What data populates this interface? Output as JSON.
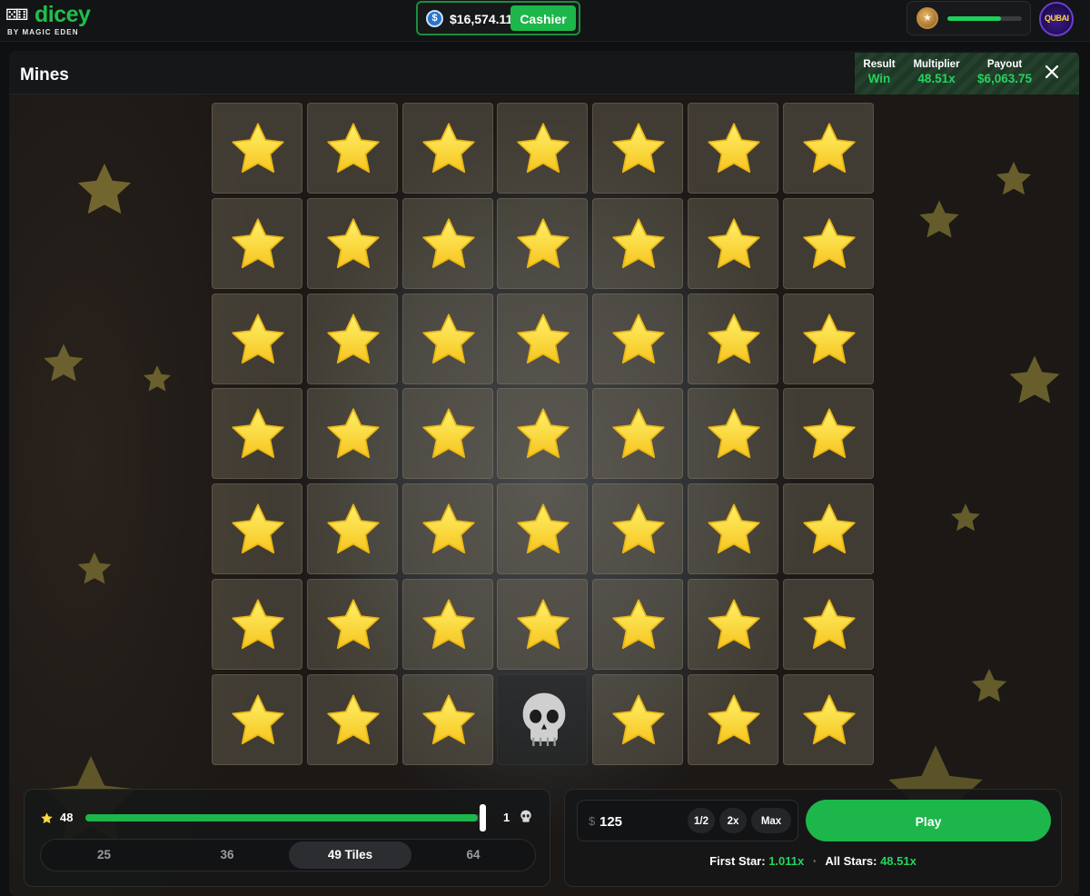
{
  "brand": {
    "logo_text": "dicey",
    "sub_text": "BY MAGIC EDEN"
  },
  "wallet": {
    "balance": "$16,574.11",
    "coin_icon": "usdc-coin-icon",
    "cashier_label": "Cashier"
  },
  "profile": {
    "xp_progress": 0.72,
    "rank_icon": "rank-badge-icon",
    "avatar_text": "QUBAI"
  },
  "game": {
    "title": "Mines",
    "result_label": "Result",
    "result_value": "Win",
    "multiplier_label": "Multiplier",
    "multiplier_value": "48.51x",
    "payout_label": "Payout",
    "payout_value": "$6,063.75"
  },
  "board": {
    "rows": 7,
    "cols": 7,
    "mine_position": [
      6,
      3
    ],
    "tile_icon": "star-icon",
    "mine_icon": "skull-icon"
  },
  "controls": {
    "stars_count": "48",
    "mines_count": "1",
    "slider_fraction": 0.98,
    "tile_options": [
      "25",
      "36",
      "49 Tiles",
      "64"
    ],
    "selected_tile_option": 2,
    "bet_currency": "$",
    "bet_amount": "125",
    "half_label": "1/2",
    "double_label": "2x",
    "max_label": "Max",
    "play_label": "Play",
    "first_star_label": "First Star:",
    "first_star_value": "1.011x",
    "all_stars_label": "All Stars:",
    "all_stars_value": "48.51x"
  },
  "colors": {
    "accent_green": "#1db64a",
    "win_green": "#22d45d",
    "star_yellow": "#ffd83a"
  }
}
